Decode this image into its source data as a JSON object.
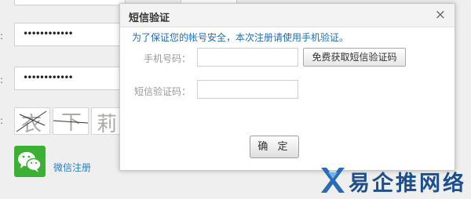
{
  "background_form": {
    "label_colon": ":",
    "password_value": "••••••••••••",
    "confirm_password_value": "••••••••••••",
    "captcha_chars": [
      "衣",
      "下",
      "莉"
    ],
    "wechat_register_label": "微信注册"
  },
  "dialog": {
    "title": "短信验证",
    "close_symbol": "×",
    "notice": "为了保证您的帐号安全，本次注册请使用手机验证。",
    "phone_label": "手机号码：",
    "phone_value": "",
    "sms_button_label": "免费获取短信验证码",
    "code_label": "短信验证码：",
    "code_value": "",
    "confirm_button_label": "确 定"
  },
  "watermark": {
    "text": "易企推网络"
  },
  "colors": {
    "accent_blue": "#1f6cb3",
    "wechat_green": "#3cb034",
    "watermark_blue": "#1d4f8f"
  }
}
